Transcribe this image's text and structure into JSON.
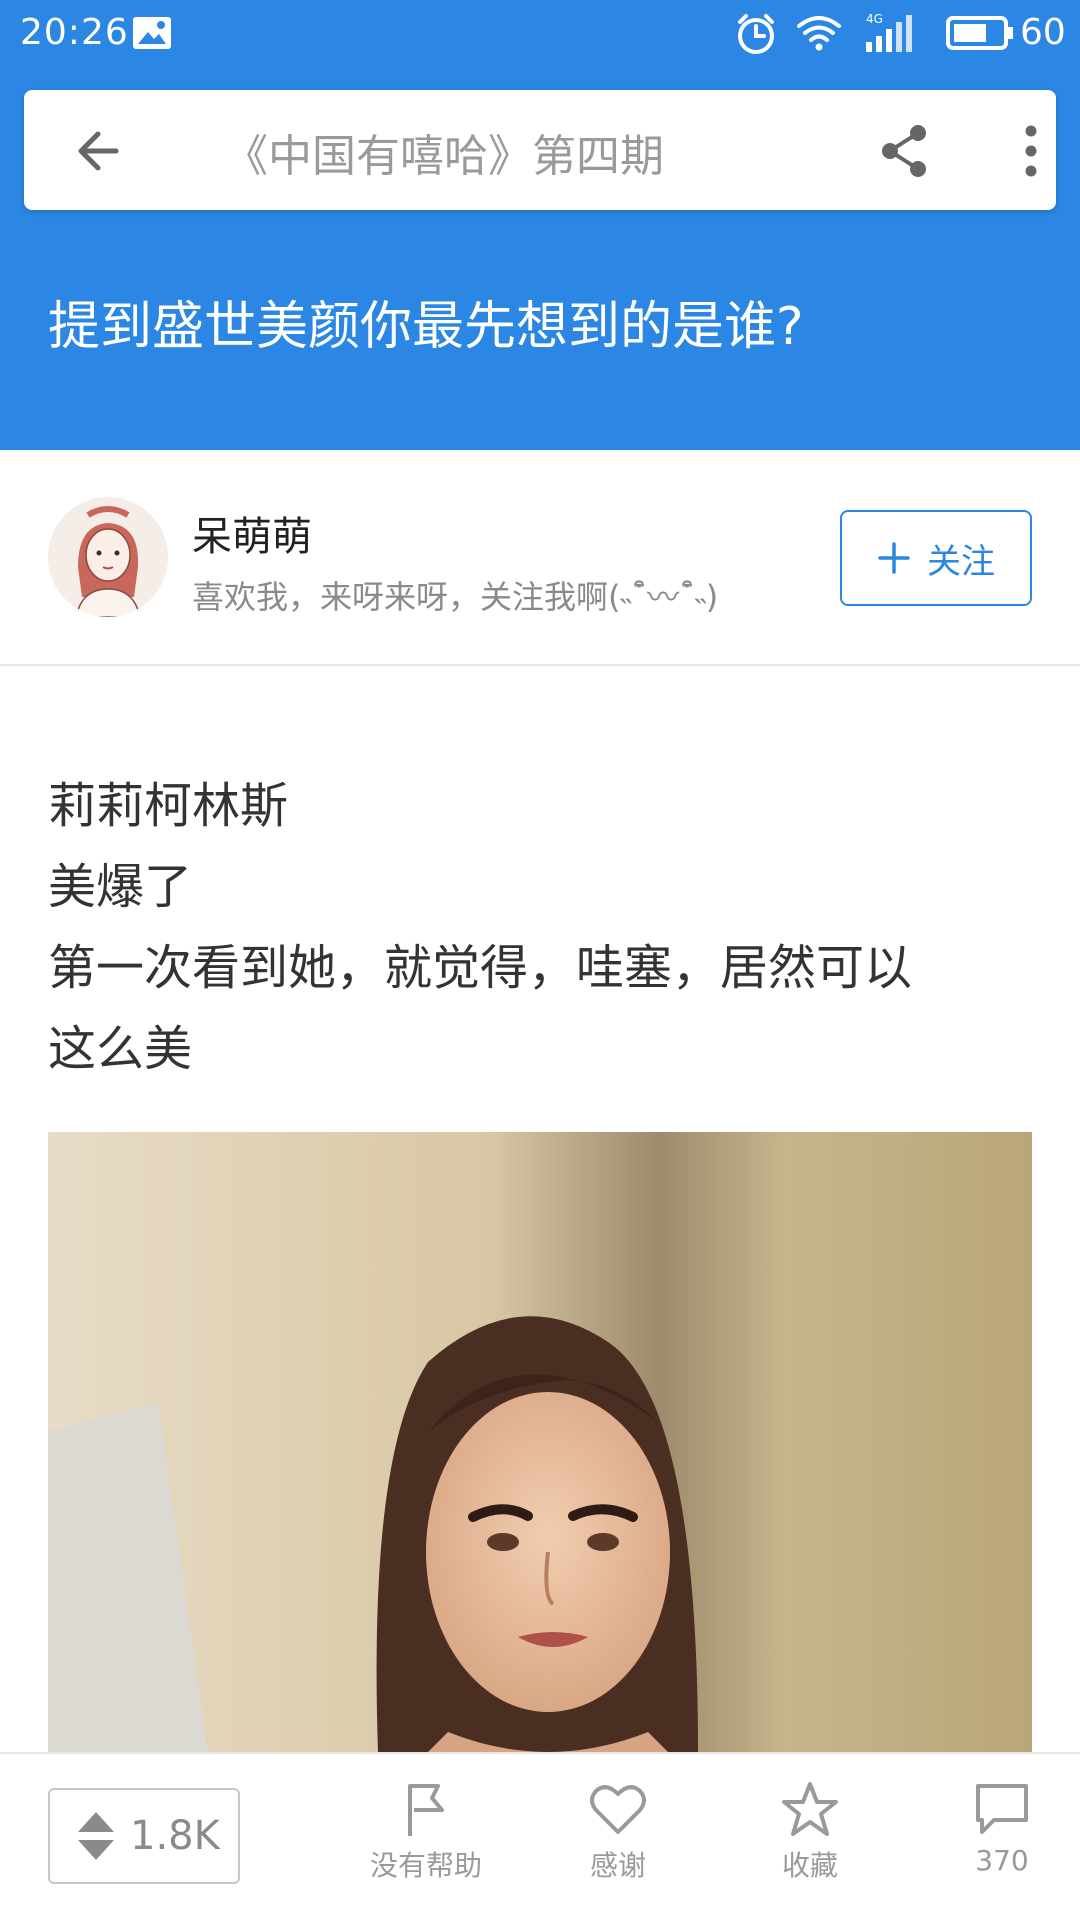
{
  "status_bar": {
    "time": "20:26",
    "battery": "60",
    "network": "4G"
  },
  "top_bar": {
    "topic_title": "《中国有嘻哈》第四期",
    "icons": [
      "back-arrow-icon",
      "share-icon",
      "more-vertical-icon"
    ]
  },
  "question": {
    "title": "提到盛世美颜你最先想到的是谁?"
  },
  "author": {
    "name": "呆萌萌",
    "bio": "喜欢我，来呀来呀，关注我啊(˵¯͒〰¯͒˵)",
    "follow_label": "关注"
  },
  "answer": {
    "lines": [
      "莉莉柯林斯",
      "美爆了",
      "第一次看到她，就觉得，哇塞，居然可以",
      "这么美"
    ]
  },
  "bottom_bar": {
    "vote_count": "1.8K",
    "no_help_label": "没有帮助",
    "thanks_label": "感谢",
    "favorite_label": "收藏",
    "comment_count": "370"
  },
  "colors": {
    "header_blue": "#2b87e3",
    "icon_gray": "#9a9a9a"
  }
}
